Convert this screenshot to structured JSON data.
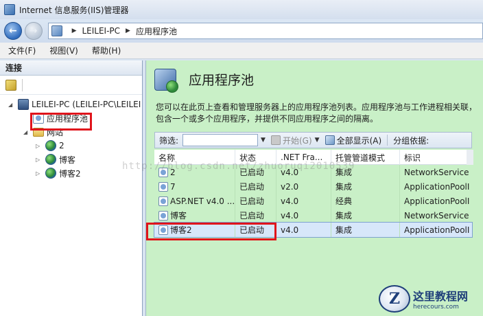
{
  "window": {
    "title": "Internet 信息服务(IIS)管理器"
  },
  "address": {
    "segments": [
      "LEILEI-PC",
      "应用程序池"
    ]
  },
  "menu": {
    "items": [
      "文件(F)",
      "视图(V)",
      "帮助(H)"
    ]
  },
  "connections": {
    "header": "连接",
    "tree": {
      "server": "LEILEI-PC (LEILEI-PC\\LEILEI",
      "app_pools": "应用程序池",
      "sites": "网站",
      "site_items": [
        "2",
        "博客",
        "博客2"
      ]
    }
  },
  "main": {
    "title": "应用程序池",
    "description": "您可以在此页上查看和管理服务器上的应用程序池列表。应用程序池与工作进程相关联，包含一个或多个应用程序，并提供不同应用程序之间的隔离。",
    "filter": {
      "label": "筛选:",
      "go": "开始(G)",
      "show_all": "全部显示(A)",
      "group_by": "分组依据:"
    },
    "grid": {
      "headers": [
        "名称",
        "状态",
        ".NET Fra...",
        "托管管道模式",
        "标识"
      ],
      "rows": [
        [
          "2",
          "已启动",
          "v4.0",
          "集成",
          "NetworkService"
        ],
        [
          "7",
          "已启动",
          "v2.0",
          "集成",
          "ApplicationPoolI"
        ],
        [
          "ASP.NET v4.0 ...",
          "已启动",
          "v4.0",
          "经典",
          "ApplicationPoolI"
        ],
        [
          "博客",
          "已启动",
          "v4.0",
          "集成",
          "NetworkService"
        ],
        [
          "博客2",
          "已启动",
          "v4.0",
          "集成",
          "ApplicationPoolI"
        ]
      ],
      "selected_row": 4
    }
  },
  "watermark": "http://blog.csdn.net/zhuoruqi2010539",
  "brand": {
    "logo_letter": "Z",
    "name": "这里教程网",
    "url": "herecours.com"
  },
  "colors": {
    "content_bg": "#c9f0c7",
    "highlight": "#e0141b",
    "selection": "#d7e7fa"
  }
}
